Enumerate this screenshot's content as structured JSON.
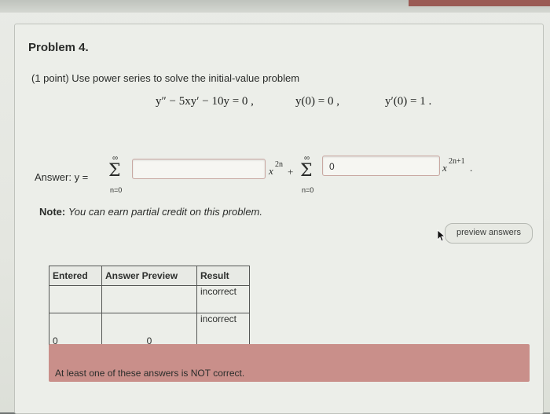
{
  "problem": {
    "title": "Problem 4.",
    "intro": "(1 point) Use power series to solve the initial-value problem",
    "equation": "y″ − 5xy′ − 10y = 0 ,",
    "ic1": "y(0) = 0 ,",
    "ic2": "y′(0) = 1 ."
  },
  "answer": {
    "label": "Answer: y =",
    "sum_symbol": "Σ",
    "upper_limit": "∞",
    "lower_limit": "n=0",
    "input1_value": "",
    "term1_base": "x",
    "term1_exp": "2n",
    "plus": "+",
    "input2_value": "0",
    "term2_base": "x",
    "term2_exp": "2n+1",
    "end_punct": "."
  },
  "note": {
    "label": "Note:",
    "text": "You can earn partial credit on this problem."
  },
  "buttons": {
    "preview": "preview answers"
  },
  "results_table": {
    "headers": [
      "Entered",
      "Answer Preview",
      "Result"
    ],
    "rows": [
      [
        "",
        "",
        "incorrect"
      ],
      [
        "0",
        "0",
        "incorrect"
      ]
    ]
  },
  "message": "At least one of these answers is NOT correct."
}
